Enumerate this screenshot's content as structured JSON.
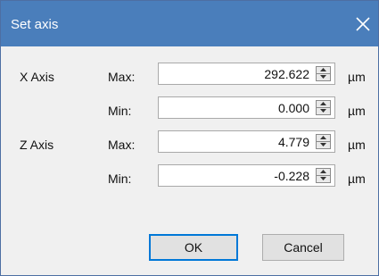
{
  "dialog": {
    "title": "Set axis",
    "close_icon": "close-icon"
  },
  "x_axis": {
    "label": "X Axis",
    "max_label": "Max:",
    "max_value": "292.622",
    "min_label": "Min:",
    "min_value": "0.000",
    "unit": "µm"
  },
  "z_axis": {
    "label": "Z Axis",
    "max_label": "Max:",
    "max_value": "4.779",
    "min_label": "Min:",
    "min_value": "-0.228",
    "unit": "µm"
  },
  "buttons": {
    "ok": "OK",
    "cancel": "Cancel"
  },
  "colors": {
    "titlebar": "#4a7ebb",
    "default_button_border": "#0078d7",
    "background": "#f0f0f0"
  }
}
